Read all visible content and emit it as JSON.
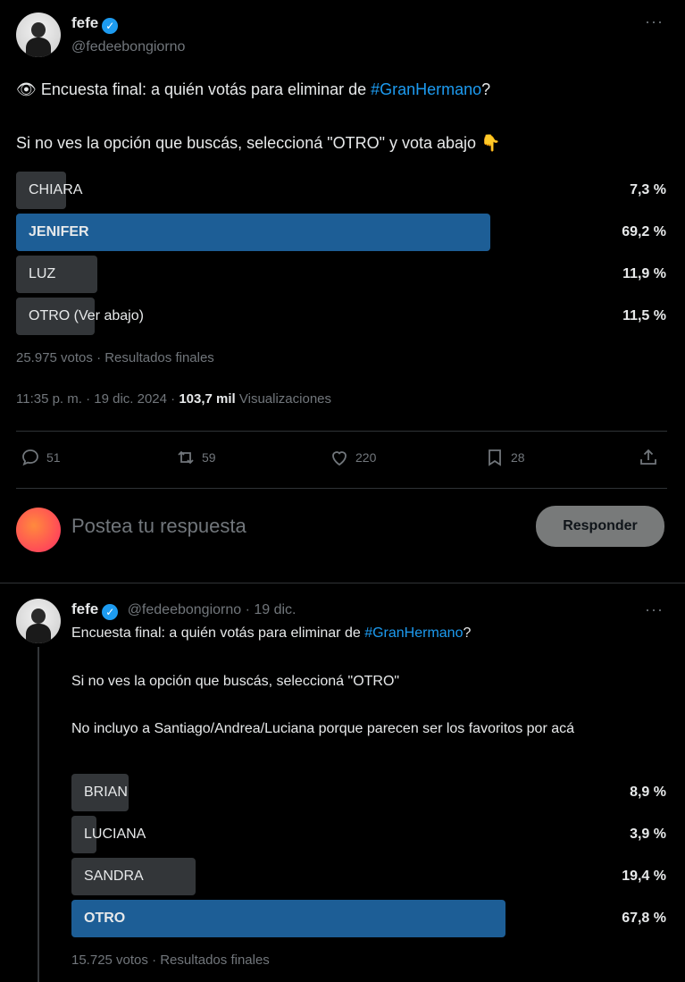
{
  "tweet1": {
    "name": "fefe",
    "handle": "@fedeebongiorno",
    "eye_emoji": "👁",
    "line1_pre": "Encuesta final: a quién votás para eliminar de ",
    "hashtag": "#GranHermano",
    "line1_post": "?",
    "line2": "Si no ves la opción que buscás, seleccioná \"OTRO\" y vota abajo",
    "point_emoji": "👇",
    "poll": [
      {
        "label": "CHIARA",
        "percent": "7,3 %",
        "value": 7.3,
        "winner": false
      },
      {
        "label": "JENIFER",
        "percent": "69,2 %",
        "value": 69.2,
        "winner": true
      },
      {
        "label": "LUZ",
        "percent": "11,9 %",
        "value": 11.9,
        "winner": false
      },
      {
        "label": "OTRO (Ver abajo)",
        "percent": "11,5 %",
        "value": 11.5,
        "winner": false
      }
    ],
    "votes": "25.975 votos · Resultados finales",
    "time": "11:35 p. m. · 19 dic. 2024 · ",
    "views_count": "103,7 mil",
    "views_label": "Visualizaciones",
    "actions": {
      "replies": "51",
      "retweets": "59",
      "likes": "220",
      "bookmarks": "28"
    }
  },
  "reply_box": {
    "placeholder": "Postea tu respuesta",
    "button": "Responder"
  },
  "tweet2": {
    "name": "fefe",
    "handle_date": "@fedeebongiorno · 19 dic.",
    "line1_pre": "Encuesta final: a quién votás para eliminar de ",
    "hashtag": "#GranHermano",
    "line1_post": "?",
    "line2": "Si no ves la opción que buscás, seleccioná \"OTRO\"",
    "line3": "No incluyo a Santiago/Andrea/Luciana porque parecen ser los favoritos por acá",
    "poll": [
      {
        "label": "BRIAN",
        "percent": "8,9 %",
        "value": 8.9,
        "winner": false
      },
      {
        "label": "LUCIANA",
        "percent": "3,9 %",
        "value": 3.9,
        "winner": false
      },
      {
        "label": "SANDRA",
        "percent": "19,4 %",
        "value": 19.4,
        "winner": false
      },
      {
        "label": "OTRO",
        "percent": "67,8 %",
        "value": 67.8,
        "winner": true
      }
    ],
    "votes": "15.725 votos · Resultados finales"
  },
  "colors": {
    "accent": "#1d9bf0",
    "winner_bar": "#1d5e96",
    "bar": "#333639"
  }
}
